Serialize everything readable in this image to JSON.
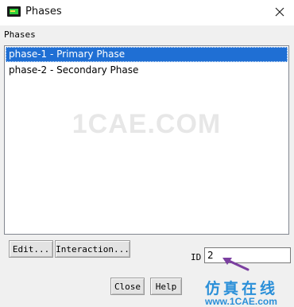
{
  "window": {
    "title": "Phases",
    "app_icon": "fluent-app-icon",
    "close_icon": "close-icon"
  },
  "phases": {
    "label": "Phases",
    "items": [
      {
        "label": "phase-1 - Primary Phase",
        "selected": true
      },
      {
        "label": "phase-2 - Secondary Phase",
        "selected": false
      }
    ]
  },
  "buttons": {
    "edit": "Edit...",
    "interaction": "Interaction...",
    "close": "Close",
    "help": "Help"
  },
  "id_field": {
    "label": "ID",
    "value": "2"
  },
  "watermark": {
    "text": "1CAE.COM",
    "logo_text": "仿真在线",
    "logo_url": "www.1CAE.com"
  },
  "colors": {
    "selection": "#1f6fd4",
    "annotation_arrow": "#7b3fa0",
    "logo": "#2a8fd8"
  }
}
